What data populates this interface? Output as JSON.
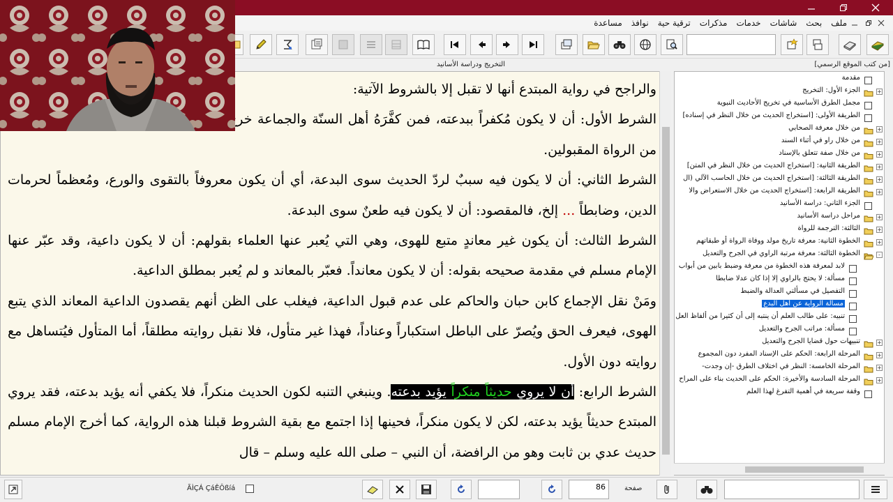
{
  "menu": {
    "items": [
      "ملف",
      "بحث",
      "شاشات",
      "خدمات",
      "مذكرات",
      "ترقية حية",
      "نوافذ",
      "مساعدة"
    ]
  },
  "panes": {
    "content_header": "التخريج ودراسة الأسانيد",
    "tree_header": "[من كتب الموقع الرسمي]"
  },
  "content": {
    "paragraphs": [
      {
        "text": "والراجح في رواية المبتدع أنها لا تقبل إلا بالشروط الآتية:"
      },
      {
        "text": "الشرط الأول: أن لا يكون مُكفراً ببدعته، فمن كفَّرَهُ أهل السنّة والجماعة خرج عن زمرة المسلمين فضلاً عن أن يكون من الرواة المقبولين."
      },
      {
        "before": "الشرط الثاني: أن لا يكون فيه سببٌ لردّ الحديث سوى البدعة، أي أن يكون معروفاً بالتقوى والورع، ومُعظماً لحرمات الدين، وضابطاً ",
        "red": "...",
        "after": " إلخ، فالمقصود: أن لا يكون فيه طعنٌ سوى البدعة."
      },
      {
        "text": "الشرط الثالث: أن يكون غير معاندٍ متبع للهوى، وهي التي يُعبر عنها العلماء بقولهم: أن لا يكون داعية، وقد عبّر عنها الإمام مسلم في مقدمة صحيحه بقوله: أن لا يكون معانداً. فعبّر بالمعاند و لم يُعبر بمطلق الداعية."
      },
      {
        "text": "ومَنْ نقل الإجماع كابن حبان والحاكم على عدم قبول الداعية، فيغلب على الظن أنهم يقصدون الداعية المعاند الذي يتبع الهوى، فيعرف الحق ويُصرّ على الباطل استكباراً وعناداً، فهذا غير متأول، فلا نقبل روايته مطلقاً، أما المتأول فيُتساهل مع روايته دون الأول."
      },
      {
        "prefix": "الشرط الرابع: ",
        "hl_before": "أن لا يروي ",
        "hl_green": "حديثاً منكراً",
        "hl_after": " يؤيد بدعته",
        "rest": ". وينبغي التنبه لكون الحديث منكراً، فلا يكفي أنه يؤيد بدعته، فقد يروي المبتدع حديثاً يؤيد بدعته، لكن لا يكون منكراً، فحينها إذا اجتمع مع بقية الشروط قبلنا هذه الرواية، كما أخرج الإمام مسلم حديث عدي بن ثابت وهو من الرافضة، أن النبي – صلى الله عليه وسلم – قال"
      }
    ]
  },
  "tree": {
    "items": [
      {
        "label": "مقدمة",
        "level": 1,
        "icon": "page-icon",
        "expander": ""
      },
      {
        "label": "الجزء الأول: التخريج",
        "level": 1,
        "icon": "folder-icon",
        "expander": "+"
      },
      {
        "label": "مجمل الطرق الأساسية في تخريج الأحاديث النبوية",
        "level": 1,
        "icon": "page-icon",
        "expander": ""
      },
      {
        "label": "الطريقة الأولى: [استخراج الحديث من خلال النظر في إسناده]",
        "level": 1,
        "icon": "page-icon",
        "expander": ""
      },
      {
        "label": "من خلال معرفة الصحابي",
        "level": 1,
        "icon": "folder-icon",
        "expander": "+"
      },
      {
        "label": "من خلال راو في أثناء السند",
        "level": 1,
        "icon": "folder-icon",
        "expander": "+"
      },
      {
        "label": "من خلال صفة تتعلق بالإسناد",
        "level": 1,
        "icon": "folder-icon",
        "expander": "+"
      },
      {
        "label": "الطريقة الثانية: [استخراج الحديث من خلال النظر في المتن]",
        "level": 1,
        "icon": "folder-icon",
        "expander": "+"
      },
      {
        "label": "الطريقة الثالثة: [استخراج الحديث من خلال الحاسب الآلي (ال",
        "level": 1,
        "icon": "folder-icon",
        "expander": "+"
      },
      {
        "label": "الطريقة الرابعة: [استخراج الحديث من خلال الاستعراض والا",
        "level": 1,
        "icon": "folder-icon",
        "expander": "+"
      },
      {
        "label": "الجزء الثاني: دراسة الأسانيد",
        "level": 1,
        "icon": "page-icon",
        "expander": ""
      },
      {
        "label": "مراحل دراسة الأسانيد",
        "level": 1,
        "icon": "folder-icon",
        "expander": "+"
      },
      {
        "label": "الثالثة: الترجمة للرواة",
        "level": 1,
        "icon": "folder-icon",
        "expander": "+"
      },
      {
        "label": "الخطوة الثانية: معرفة تاريخ مولد ووفاة الرواة أو طبقاتهم",
        "level": 1,
        "icon": "folder-icon",
        "expander": "+"
      },
      {
        "label": "الخطوة الثالثة: معرفة مرتبة الراوي في الجرح والتعديل",
        "level": 1,
        "icon": "open-folder-icon",
        "expander": "-"
      },
      {
        "label": "لابد لمعرفة هذه الخطوة من معرفة وضبط بابين من أبواب",
        "level": 2,
        "icon": "page-icon",
        "expander": ""
      },
      {
        "label": "مسألة: لا يحتج بالراوي إلا إذا كان عدلا ضابطا",
        "level": 2,
        "icon": "page-icon",
        "expander": ""
      },
      {
        "label": "التفصيل في مسألتي العدالة والضبط",
        "level": 2,
        "icon": "page-icon",
        "expander": ""
      },
      {
        "label": "مسألة الرواية عن أهل البدع",
        "level": 2,
        "icon": "page-icon",
        "expander": "",
        "selected": true
      },
      {
        "label": "تنبيه: على طالب العلم أن ينتبه إلى أن كثيرا من ألفاظ العل",
        "level": 2,
        "icon": "page-icon",
        "expander": ""
      },
      {
        "label": "مسألة: مراتب الجرح والتعديل",
        "level": 2,
        "icon": "page-icon",
        "expander": ""
      },
      {
        "label": "تنبيهات حول قضايا الجرح والتعديل",
        "level": 1,
        "icon": "folder-icon",
        "expander": "+"
      },
      {
        "label": "المرحلة الرابعة: الحكم على الإسناد المفرد دون المجموع",
        "level": 1,
        "icon": "folder-icon",
        "expander": "+"
      },
      {
        "label": "المرحلة الخامسة: النظر في اختلاف الطرق -إن وجدت-",
        "level": 1,
        "icon": "folder-icon",
        "expander": "+"
      },
      {
        "label": "المرحلة السادسة والأخيرة: الحكم على الحديث بناء على المراح",
        "level": 1,
        "icon": "folder-icon",
        "expander": "+"
      },
      {
        "label": "وقفة سريعة في أهمية التفرغ لهذا العلم",
        "level": 1,
        "icon": "page-icon",
        "expander": ""
      }
    ]
  },
  "bottom": {
    "page_label": "صفحة",
    "page_number": "86",
    "garbled_label": "ÃÌÇÁ ÇáÊÔßíá"
  },
  "colors": {
    "titlebar": "#8b0d24",
    "content_bg": "#fbf8ea",
    "highlight_bg": "#000000",
    "highlight_green": "#1fd21f",
    "red_text": "#c00000",
    "selection": "#0a64d8"
  }
}
